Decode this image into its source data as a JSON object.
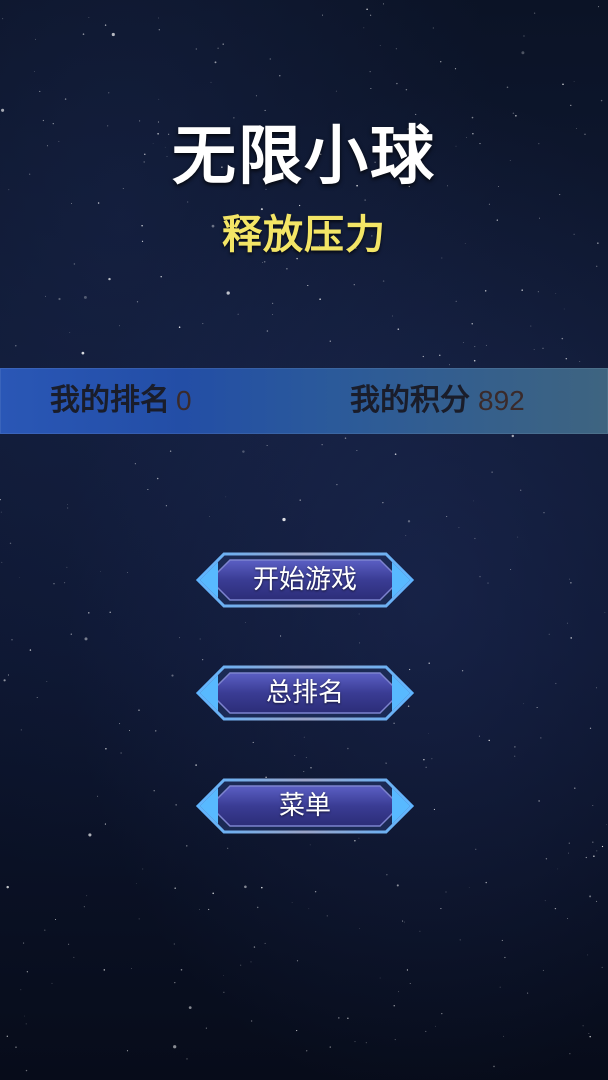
{
  "header": {
    "title": "无限小球",
    "subtitle": "释放压力"
  },
  "stats": {
    "rank_label": "我的排名",
    "rank_value": "0",
    "score_label": "我的积分",
    "score_value": "892"
  },
  "menu": {
    "start_label": "开始游戏",
    "leaderboard_label": "总排名",
    "menu_label": "菜单"
  },
  "colors": {
    "title": "#ffffff",
    "subtitle": "#f3e566",
    "stats_bar": "#2a57b6",
    "button_face": "#3b3f9a",
    "button_frame": "#4a9ef0"
  }
}
